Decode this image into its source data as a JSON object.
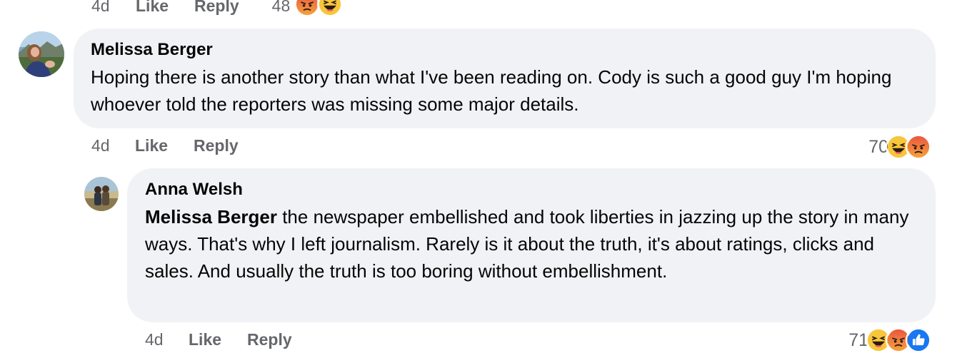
{
  "previous_comment": {
    "time": "4d",
    "like_label": "Like",
    "reply_label": "Reply",
    "reaction_count": "48",
    "reactions": [
      "angry-icon",
      "haha-icon"
    ]
  },
  "comments": [
    {
      "author": "Melissa Berger",
      "text": "Hoping there is another story than what I've been reading on. Cody is such a good guy I'm hoping whoever told the reporters was missing some major details.",
      "time": "4d",
      "like_label": "Like",
      "reply_label": "Reply",
      "reaction_count": "70",
      "reactions": [
        "haha-icon",
        "angry-icon"
      ]
    },
    {
      "author": "Anna Welsh",
      "mention": "Melissa Berger",
      "text": " the newspaper embellished and took liberties in jazzing up the story in many ways. That's why I left journalism. Rarely is it about the truth, it's about ratings, clicks and sales. And usually the truth is too boring without embellishment.",
      "time": "4d",
      "like_label": "Like",
      "reply_label": "Reply",
      "reaction_count": "71",
      "reactions": [
        "haha-icon",
        "angry-icon",
        "like-icon"
      ]
    }
  ],
  "colors": {
    "bubble": "#f0f2f5",
    "meta_text": "#65676b",
    "body_text": "#050505",
    "like_blue": "#1877f2",
    "haha_yellow": "#f7c63b",
    "angry_red": "#e9573f"
  }
}
